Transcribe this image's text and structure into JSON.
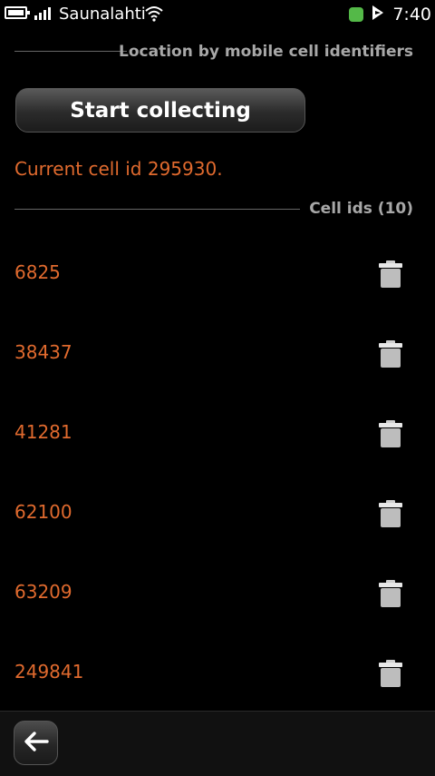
{
  "status_bar": {
    "carrier": "Saunalahti",
    "time": "7:40",
    "icons": [
      "battery-icon",
      "signal-strength-icon",
      "wifi-icon",
      "notification-icon",
      "clock-icon"
    ]
  },
  "header": {
    "title": "Location by mobile cell identifiers"
  },
  "actions": {
    "start_label": "Start collecting"
  },
  "current_cell": {
    "text": "Current cell id 295930."
  },
  "cell_list": {
    "title": "Cell ids (10)",
    "items": [
      {
        "id": "6825"
      },
      {
        "id": "38437"
      },
      {
        "id": "41281"
      },
      {
        "id": "62100"
      },
      {
        "id": "63209"
      },
      {
        "id": "249841"
      }
    ]
  },
  "colors": {
    "accent": "#e06a2e",
    "background": "#000000",
    "section_title": "#a8a8a8"
  },
  "toolbar": {
    "back_icon": "back-arrow-icon"
  }
}
